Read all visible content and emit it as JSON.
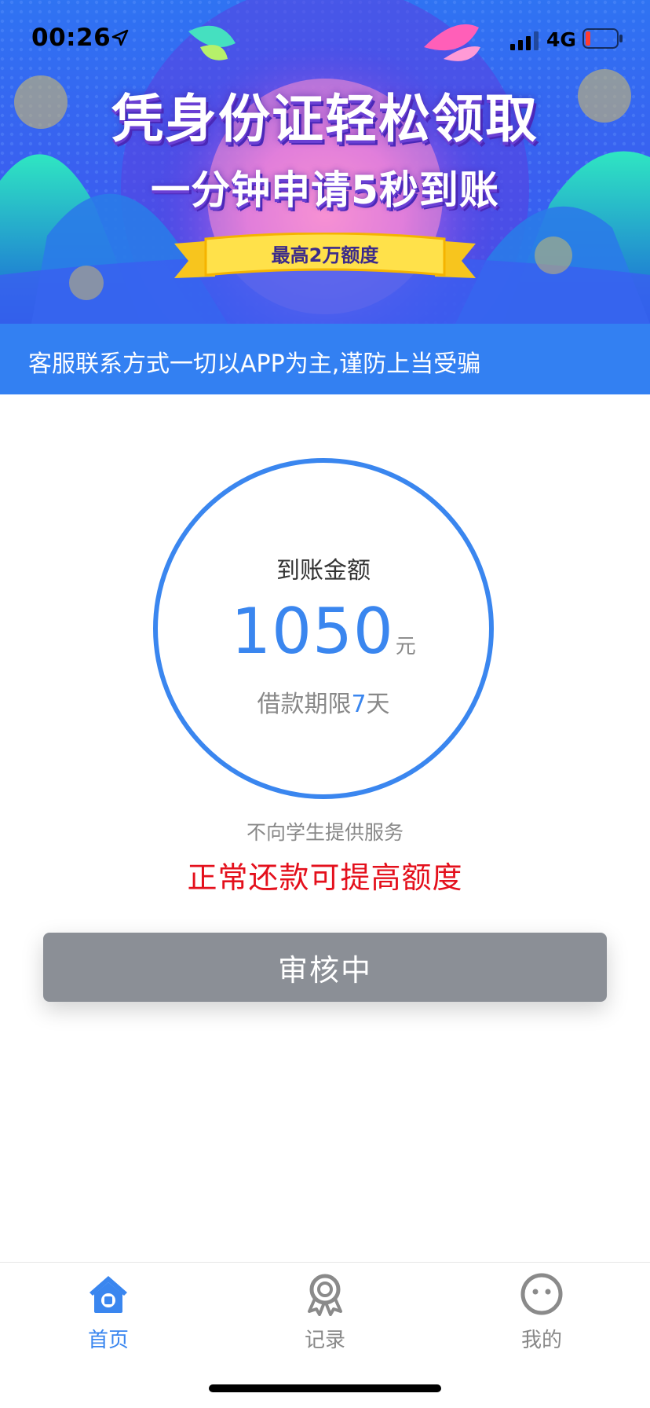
{
  "status_bar": {
    "time": "00:26",
    "network": "4G"
  },
  "banner": {
    "headline": "凭身份证轻松领取",
    "subheadline": "一分钟申请5秒到账",
    "ribbon_text": "最高2万额度"
  },
  "notice": {
    "text": "客服联系方式一切以APP为主,谨防上当受骗"
  },
  "amount_card": {
    "label": "到账金额",
    "value": "1050",
    "unit": "元",
    "term_prefix": "借款期限",
    "term_days": "7",
    "term_suffix": "天"
  },
  "disclaimer": "不向学生提供服务",
  "repay_tip": "正常还款可提高额度",
  "review_button": {
    "label": "审核中"
  },
  "tab_bar": {
    "items": [
      {
        "label": "首页",
        "icon": "home-icon",
        "active": true
      },
      {
        "label": "记录",
        "icon": "records-icon",
        "active": false
      },
      {
        "label": "我的",
        "icon": "profile-icon",
        "active": false
      }
    ]
  },
  "colors": {
    "accent": "#3a86ef",
    "notice_bg": "#3380f2",
    "warning_red": "#e4101c",
    "disabled_button": "#8b8f96"
  }
}
